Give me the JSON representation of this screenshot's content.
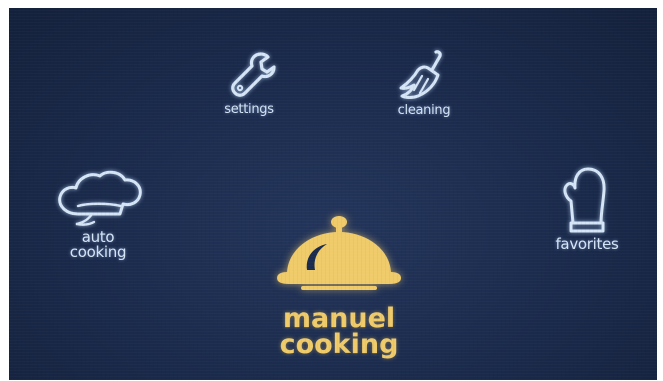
{
  "menu": {
    "settings": {
      "label": "settings",
      "icon": "wrench-icon"
    },
    "cleaning": {
      "label": "cleaning",
      "icon": "broom-icon"
    },
    "auto_cooking": {
      "label": "auto\ncooking",
      "icon": "chef-hat-icon"
    },
    "favorites": {
      "label": "favorites",
      "icon": "oven-mitt-icon"
    },
    "manual_cooking": {
      "label": "manuel\ncooking",
      "icon": "cloche-icon"
    }
  },
  "colors": {
    "background": "#1c2c4e",
    "icon_line": "#d6e6f7",
    "highlight": "#f0cb6a"
  }
}
